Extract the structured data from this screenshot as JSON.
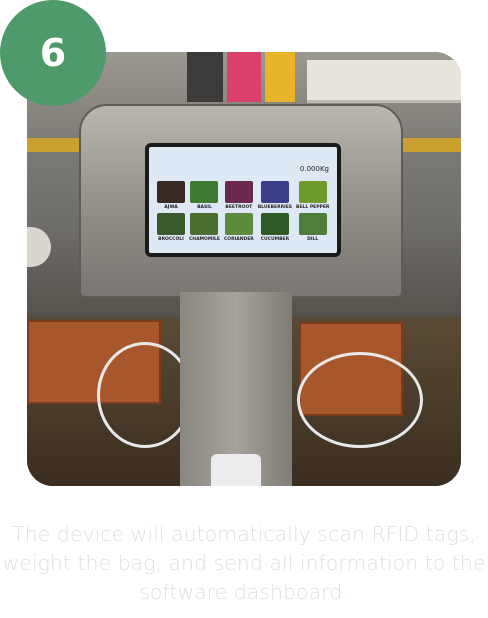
{
  "step": {
    "number": "6",
    "color": "#4e9a6a"
  },
  "device_screen": {
    "header_left": "",
    "status": "",
    "weight": "0.000Kg",
    "tiles": [
      {
        "label": "AJWA",
        "color": "#3a2a24"
      },
      {
        "label": "BASIL",
        "color": "#3f7a33"
      },
      {
        "label": "BEETROOT",
        "color": "#6b2a4d"
      },
      {
        "label": "BLUEBERRIES",
        "color": "#3b3d8a"
      },
      {
        "label": "BELL PEPPER",
        "color": "#6f9a2c"
      },
      {
        "label": "BROCCOLI",
        "color": "#37592b"
      },
      {
        "label": "CHAMOMILE",
        "color": "#4a6e2f"
      },
      {
        "label": "CORIANDER",
        "color": "#5b8c3a"
      },
      {
        "label": "CUCUMBER",
        "color": "#2f5a26"
      },
      {
        "label": "DILL",
        "color": "#4f7d3b"
      }
    ]
  },
  "caption": "The device will automatically scan RFID tags, weight the bag, and send all information to the software dashboard."
}
